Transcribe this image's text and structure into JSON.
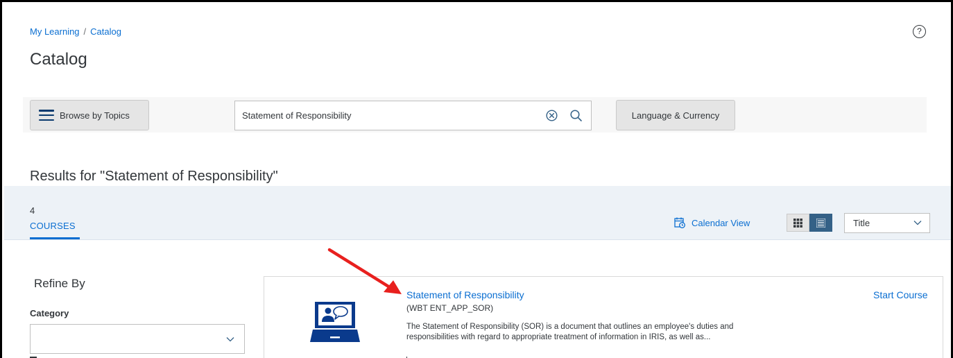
{
  "breadcrumb": {
    "items": [
      "My Learning",
      "Catalog"
    ],
    "separator": "/"
  },
  "header": {
    "title": "Catalog",
    "help_icon": "help-circle-icon",
    "help_glyph": "?"
  },
  "toolbar": {
    "browse_label": "Browse by Topics",
    "browse_icon": "hamburger-menu-icon",
    "search_value": "Statement of Responsibility",
    "clear_icon": "clear-circle-icon",
    "search_icon": "magnifier-icon",
    "language_label": "Language & Currency"
  },
  "results": {
    "title": "Results for \"Statement of Responsibility\""
  },
  "tabs": [
    {
      "count": "4",
      "label": "COURSES",
      "selected": true
    }
  ],
  "view_controls": {
    "calendar_label": "Calendar View",
    "calendar_icon": "calendar-icon",
    "grid_icon": "grid-view-icon",
    "list_icon": "list-view-icon",
    "active_view": "list",
    "sort_value": "Title",
    "sort_icon": "chevron-down-icon"
  },
  "filters": {
    "title": "Refine By",
    "category_label": "Category",
    "category_value": ""
  },
  "courses": [
    {
      "title": "Statement of Responsibility",
      "id": "(WBT ENT_APP_SOR)",
      "description": "The Statement of Responsibility (SOR) is a document that outlines an employee's duties and responsibilities with regard to appropriate treatment of information in IRIS, as well as...",
      "action": "Start Course",
      "thumbnail_icon": "laptop-presenter-icon"
    }
  ],
  "annotation": {
    "arrow_icon": "red-arrow-icon",
    "arrow_color": "#e8201e"
  },
  "colors": {
    "accent": "#0a6ed1",
    "text": "#32363a",
    "band": "#edf2f7",
    "button_bg": "#e5e5e5",
    "active_toggle": "#346187",
    "thumbnail": "#0a3a8c"
  }
}
